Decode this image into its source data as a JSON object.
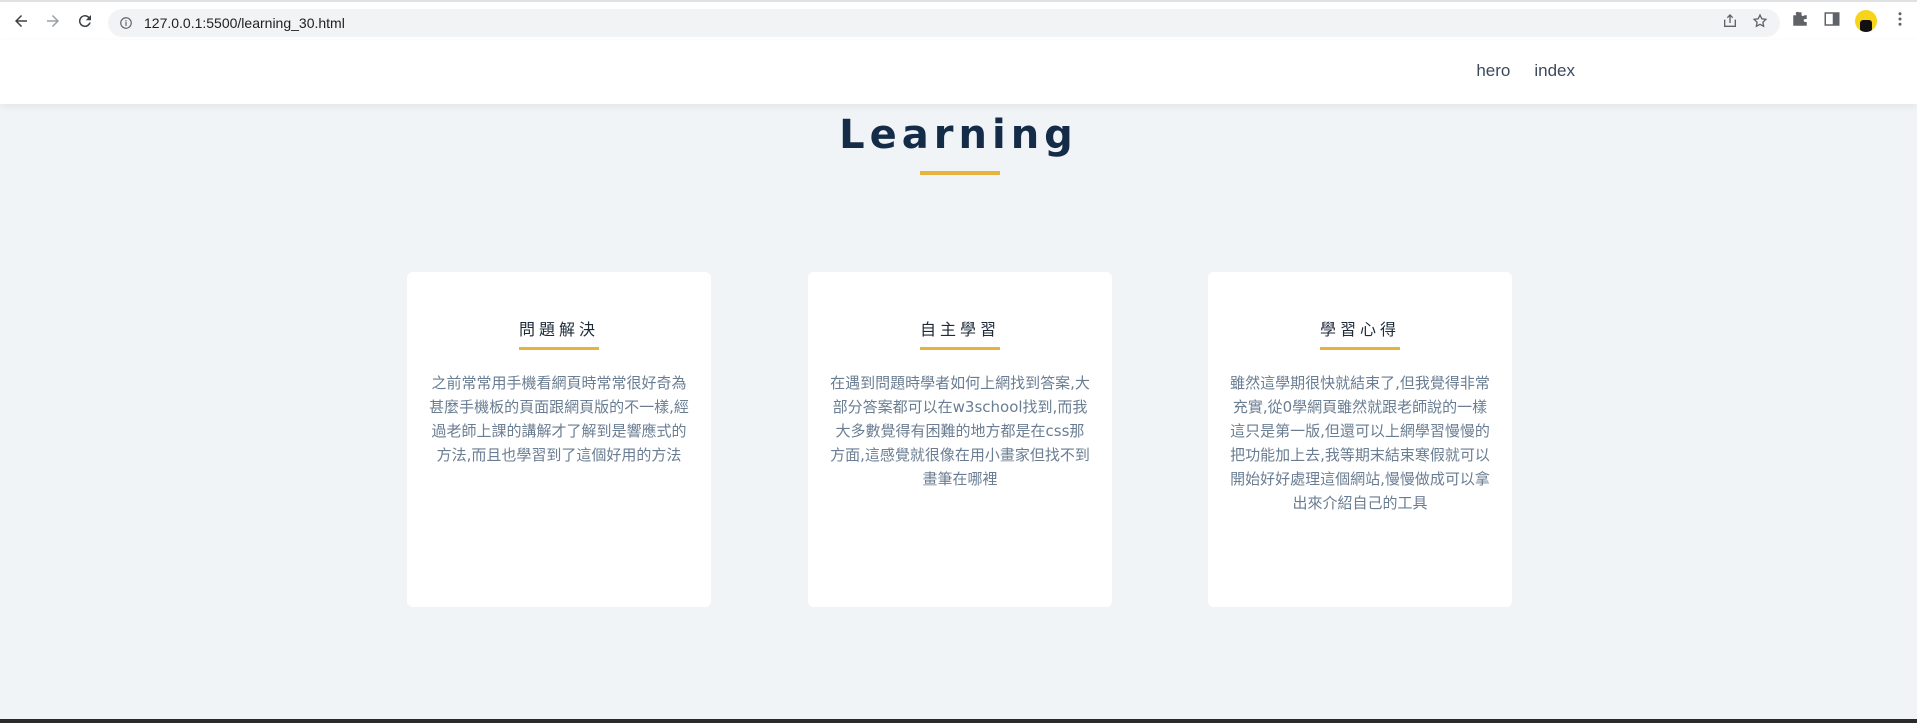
{
  "browser": {
    "url": "127.0.0.1:5500/learning_30.html"
  },
  "nav": {
    "links": [
      "hero",
      "index"
    ]
  },
  "section": {
    "title": "Learning"
  },
  "cards": [
    {
      "title": "問題解決",
      "text": "之前常常用手機看網頁時常常很好奇為甚麼手機板的頁面跟網頁版的不一樣,經過老師上課的講解才了解到是響應式的方法,而且也學習到了這個好用的方法"
    },
    {
      "title": "自主學習",
      "text": "在遇到問題時學者如何上網找到答案,大部分答案都可以在w3school找到,而我大多數覺得有困難的地方都是在css那方面,這感覺就很像在用小畫家但找不到畫筆在哪裡"
    },
    {
      "title": "學習心得",
      "text": "雖然這學期很快就結束了,但我覺得非常充實,從0學網頁雖然就跟老師說的一樣這只是第一版,但還可以上網學習慢慢的把功能加上去,我等期末結束寒假就可以開始好好處理這個網站,慢慢做成可以拿出來介紹自己的工具"
    }
  ],
  "colors": {
    "accent": "#e6b43c",
    "title": "#152c48",
    "background": "#f1f4f7"
  }
}
